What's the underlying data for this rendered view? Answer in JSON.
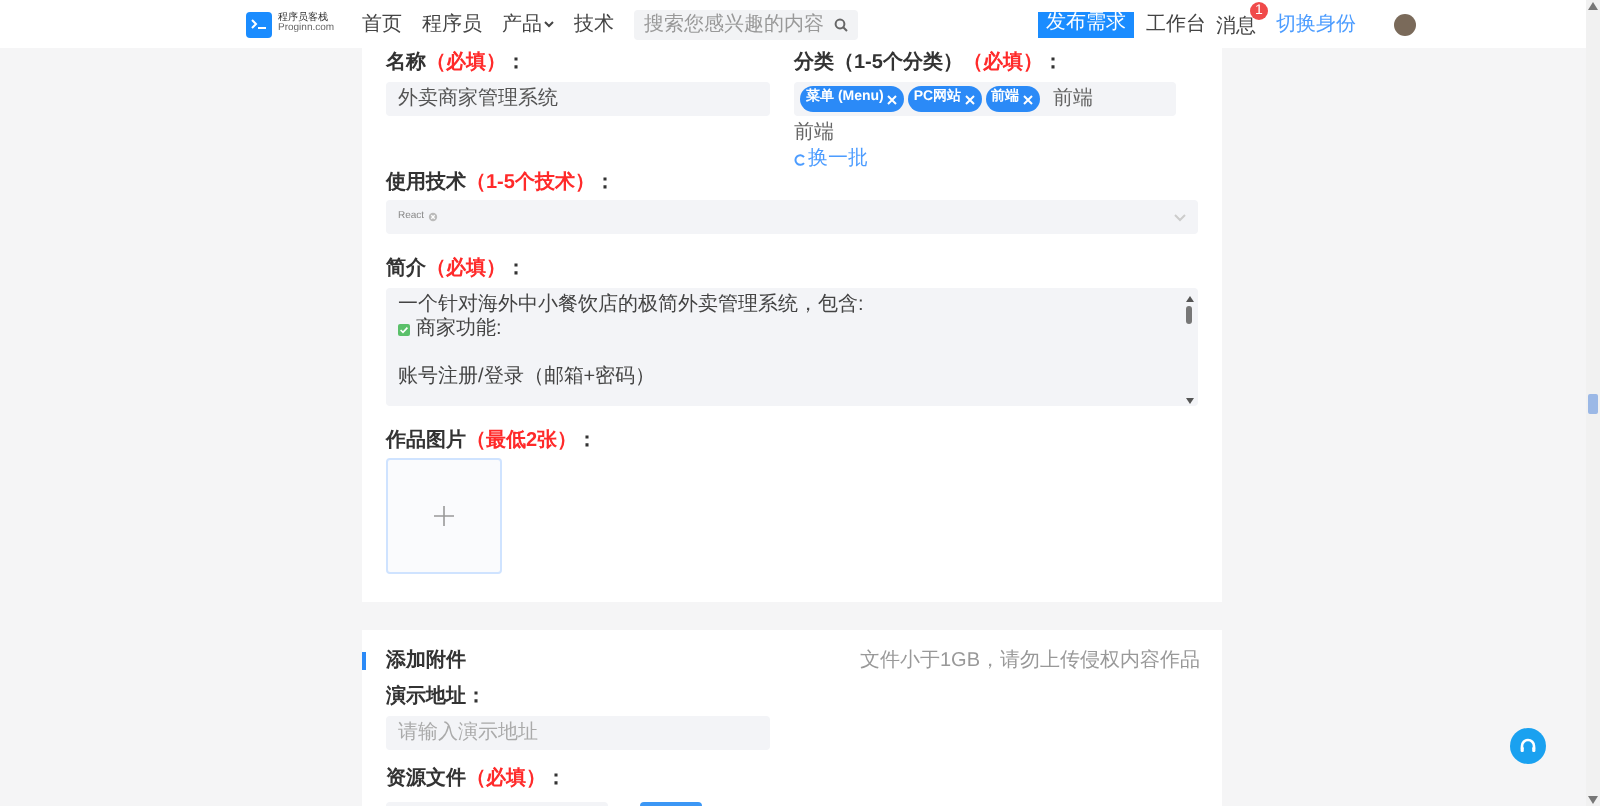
{
  "header": {
    "logo": {
      "title": "程序员客栈",
      "subtitle": "Proginn.com"
    },
    "nav": [
      {
        "label": "首页",
        "dropdown": false
      },
      {
        "label": "程序员",
        "dropdown": false
      },
      {
        "label": "产品",
        "dropdown": true
      },
      {
        "label": "技术",
        "dropdown": false
      }
    ],
    "search": {
      "placeholder": "搜索您感兴趣的内容"
    },
    "publish_button": "发布需求",
    "workbench": "工作台",
    "messages": {
      "label": "消息",
      "badge": "1"
    },
    "switch_identity": "切换身份"
  },
  "form": {
    "name": {
      "label": "名称",
      "required": "（必填）",
      "colon": "：",
      "value": "外卖商家管理系统"
    },
    "category": {
      "label": "分类（1-5个分类）",
      "required": "（必填）",
      "colon": "：",
      "tags": [
        "菜单 (Menu)",
        "PC网站",
        "前端"
      ],
      "input_value": "前端",
      "suggestions": [
        "前端"
      ],
      "refresh": "换一批"
    },
    "tech": {
      "label": "使用技术",
      "required": "（1-5个技术）",
      "colon": "：",
      "tags": [
        "React"
      ]
    },
    "intro": {
      "label": "简介",
      "required": "（必填）",
      "colon": "：",
      "lines": [
        {
          "kind": "text",
          "text": "一个针对海外中小餐饮店的极简外卖管理系统，包含:"
        },
        {
          "kind": "check",
          "text": "商家功能:"
        },
        {
          "kind": "blank"
        },
        {
          "kind": "text",
          "text": "账号注册/登录（邮箱+密码）"
        }
      ]
    },
    "images": {
      "label": "作品图片",
      "required": "（最低2张）",
      "colon": "："
    }
  },
  "attachments": {
    "title": "添加附件",
    "hint": "文件小于1GB，请勿上传侵权内容作品",
    "demo": {
      "label": "演示地址：",
      "placeholder": "请输入演示地址"
    },
    "resource": {
      "label": "资源文件",
      "required": "（必填）",
      "colon": "："
    }
  }
}
